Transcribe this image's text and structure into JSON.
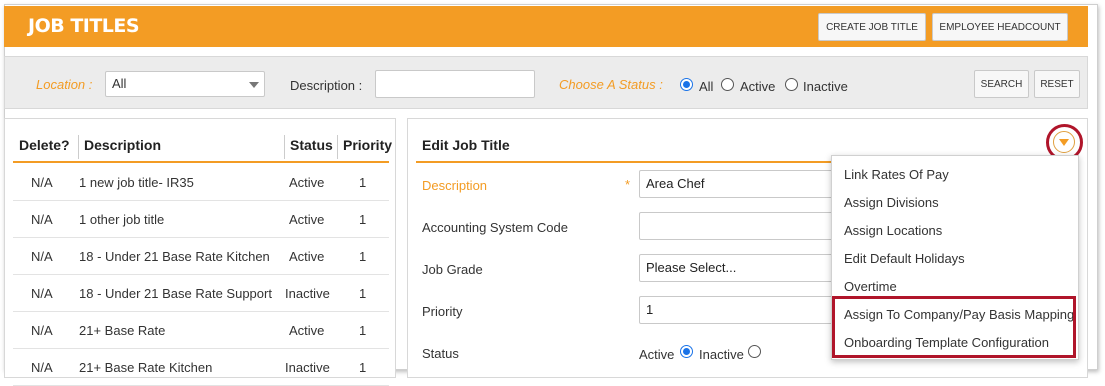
{
  "header": {
    "title": "JOB TITLES",
    "create_button": "CREATE JOB TITLE",
    "headcount_button": "EMPLOYEE HEADCOUNT",
    "accent_color": "#f39c24"
  },
  "filters": {
    "location_label": "Location :",
    "location_value": "All",
    "description_label": "Description :",
    "description_value": "",
    "status_label": "Choose A Status :",
    "status_options": [
      "All",
      "Active",
      "Inactive"
    ],
    "status_selected": "All",
    "search_button": "SEARCH",
    "reset_button": "RESET"
  },
  "table": {
    "columns": [
      "Delete?",
      "Description",
      "Status",
      "Priority"
    ],
    "rows": [
      {
        "delete": "N/A",
        "description": "1 new job title- IR35",
        "status": "Active",
        "priority": "1"
      },
      {
        "delete": "N/A",
        "description": "1 other job title",
        "status": "Active",
        "priority": "1"
      },
      {
        "delete": "N/A",
        "description": "18 - Under 21 Base Rate Kitchen",
        "status": "Active",
        "priority": "1"
      },
      {
        "delete": "N/A",
        "description": "18 - Under 21 Base Rate Support",
        "status": "Inactive",
        "priority": "1"
      },
      {
        "delete": "N/A",
        "description": "21+ Base Rate",
        "status": "Active",
        "priority": "1"
      },
      {
        "delete": "N/A",
        "description": "21+ Base Rate Kitchen",
        "status": "Inactive",
        "priority": "1"
      }
    ]
  },
  "edit": {
    "title": "Edit  Job Title",
    "description_label": "Description",
    "required_marker": "*",
    "description_value": "Area Chef",
    "accounting_label": "Accounting System Code",
    "accounting_value": "",
    "job_grade_label": "Job Grade",
    "job_grade_value": "Please Select...",
    "priority_label": "Priority",
    "priority_value": "1",
    "status_label": "Status",
    "status_options": [
      "Active",
      "Inactive"
    ],
    "status_selected": "Active"
  },
  "menu": {
    "items": [
      "Link Rates Of Pay",
      "Assign Divisions",
      "Assign Locations",
      "Edit Default Holidays",
      "Overtime",
      "Assign To Company/Pay Basis Mapping",
      "Onboarding Template Configuration"
    ]
  }
}
